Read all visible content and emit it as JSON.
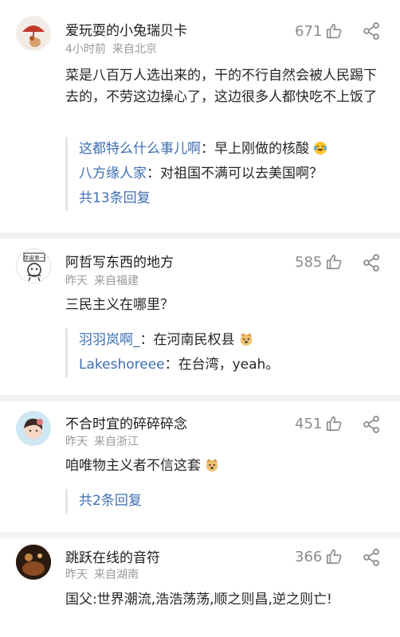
{
  "comments": [
    {
      "username": "爱玩耍的小兔瑞贝卡",
      "time": "4小时前",
      "location": "来自北京",
      "likes": "671",
      "text": "菜是八百万人选出来的，干的不行自然会被人民踢下去的，不劳这边操心了，这边很多人都快吃不上饭了",
      "replies": [
        {
          "name": "这都特么什么事儿啊",
          "text": "：早上刚做的核酸",
          "emoji": "laughing-tears-emoji"
        },
        {
          "name": "八方缘人家",
          "text": "：对祖国不满可以去美国啊？"
        }
      ],
      "more": "共13条回复"
    },
    {
      "username": "阿哲写东西的地方",
      "time": "昨天",
      "location": "来自福建",
      "likes": "585",
      "text": "三民主义在哪里？",
      "replies": [
        {
          "name": "羽羽岚啊_",
          "text": "：在河南民权县",
          "emoji": "doge-emoji"
        },
        {
          "name": "Lakeshoreee",
          "text": "：在台湾，yeah。"
        }
      ]
    },
    {
      "username": "不合时宜的碎碎碎念",
      "time": "昨天",
      "location": "来自浙江",
      "likes": "451",
      "text": "咱唯物主义者不信这套",
      "text_emoji": "doge-emoji",
      "more": "共2条回复"
    },
    {
      "username": "跳跃在线的音符",
      "time": "昨天",
      "location": "来自湖南",
      "likes": "366",
      "text": "国父:世界潮流,浩浩荡荡,顺之则昌,逆之则亡!"
    }
  ],
  "avatar_badge": "宇宙第一",
  "icons": {
    "like": "thumbs-up-icon",
    "share": "share-icon"
  },
  "colors": {
    "link": "#3f6fb3",
    "meta": "#9a9a9a",
    "divider": "#f2f2f2"
  }
}
